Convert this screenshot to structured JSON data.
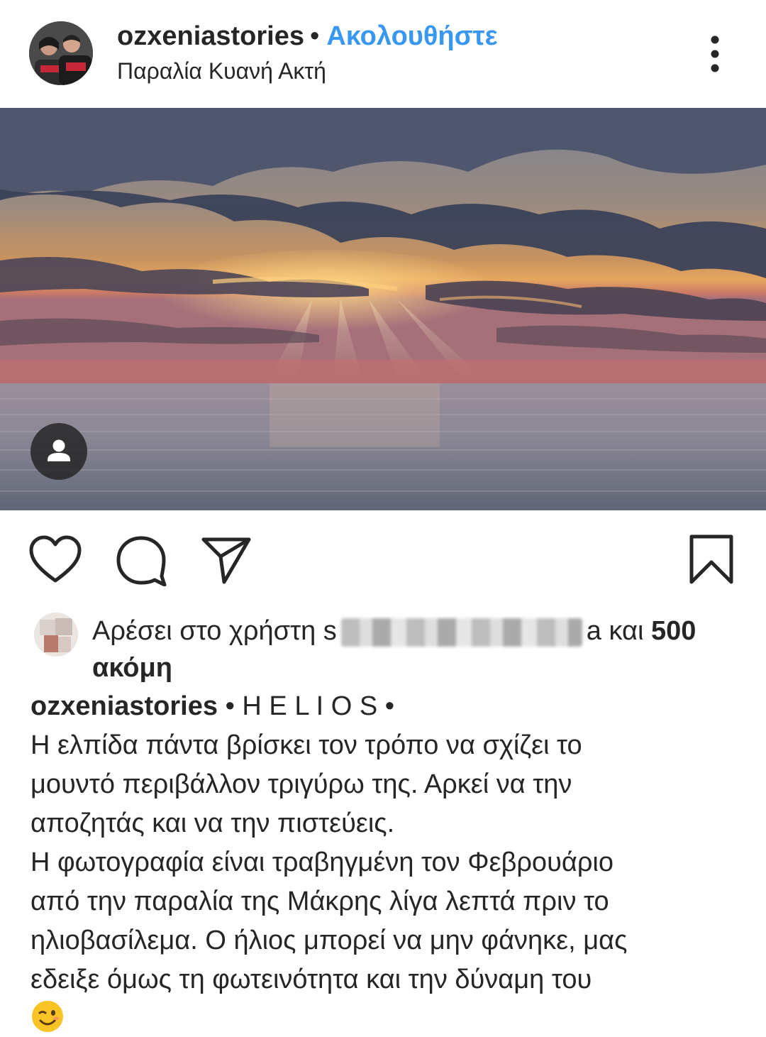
{
  "post": {
    "username": "ozxeniastories",
    "separator": "•",
    "follow_label": "Ακολουθήστε",
    "location": "Παραλία Κυανή Ακτή"
  },
  "actions": {
    "like": "heart-icon",
    "comment": "comment-icon",
    "share": "send-icon",
    "save": "bookmark-icon"
  },
  "likes": {
    "prefix": "Αρέσει στο χρήστη",
    "name_visible_start": "s",
    "name_visible_end": "a",
    "and": "και",
    "count": "500",
    "more": "ακόμη"
  },
  "caption": {
    "username": "ozxeniastories",
    "title": "• H E L I O S •",
    "lines": [
      "Η ελπίδα πάντα βρίσκει τον τρόπο να σχίζει το",
      "μουντό περιβάλλον τριγύρω της. Αρκεί να την",
      "αποζητάς και να την πιστεύεις.",
      "Η φωτογραφία είναι τραβηγμένη τον Φεβρουάριο",
      "από την παραλία της Μάκρης λίγα λεπτά πριν το",
      "ηλιοβασίλεμα. Ο ήλιος μπορεί να μην φάνηκε, μας",
      "εδειξε όμως τη φωτεινότητα και την δύναμη του"
    ]
  },
  "colors": {
    "follow": "#3897f0",
    "text": "#262626"
  }
}
